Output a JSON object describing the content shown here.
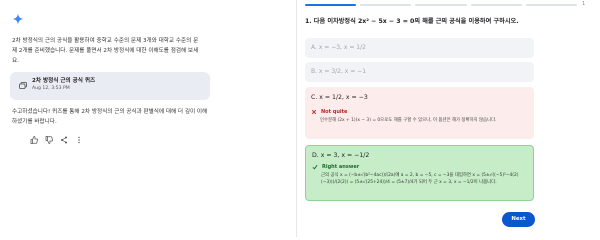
{
  "chat": {
    "intro": "2차 방정식의 근의 공식을 활용하여 중학교 수준의 문제 3개와 대학교 수준의 문제 2개를 준비했습니다. 문제를 풀면서 2차 방정식에 대한 이해도를 점검해 보세요.",
    "quiz_card": {
      "title": "2차 방정식 근의 공식 퀴즈",
      "date": "Aug 12, 3:53 PM"
    },
    "outro": "수고하셨습니다! 퀴즈를 통해 2차 방정식의 근의 공식과 판별식에 대해 더 깊이 이해하셨기를 바랍니다.",
    "icons": [
      "gemini-spark-icon",
      "thumbs-up-icon",
      "thumbs-down-icon",
      "share-icon",
      "more-icon"
    ]
  },
  "quiz": {
    "progress": {
      "current": 1,
      "total": 5
    },
    "counter": "1",
    "question": "1. 다음 이차방정식 2x² − 5x − 3 = 0의 해를 근의 공식을 이용하여 구하시오.",
    "options": [
      {
        "label": "A. x = −3, x = 1/2",
        "state": "disabled"
      },
      {
        "label": "B. x = 3/2, x = −1",
        "state": "disabled"
      },
      {
        "label": "C. x = 1/2, x = −3",
        "state": "incorrect",
        "feedback_title": "Not quite",
        "feedback": "인수분해 (2x + 1)(x − 3) = 0으로도 해를 구할 수 있으나, 이 옵션은 해가 정확하지 않습니다."
      },
      {
        "label": "D. x = 3, x = −1/2",
        "state": "correct",
        "feedback_title": "Right answer",
        "feedback": "근의 공식 x = (−b±√(b²−4ac))/(2a)에 a = 2, b = −5, c = −3을 대입하면 x = (5±√((−5)²−4(2)(−3)))/(2(2)) = (5±√(25+24))/4 = (5±7)/4가 되어 두 근 x = 3, x = −1/2이 나옵니다."
      }
    ],
    "next_label": "Next"
  },
  "colors": {
    "accent": "#0b57d0",
    "correct_bg": "#c6ecc8",
    "incorrect_bg": "#fdecec",
    "neutral_bg": "#f1f3f6"
  }
}
